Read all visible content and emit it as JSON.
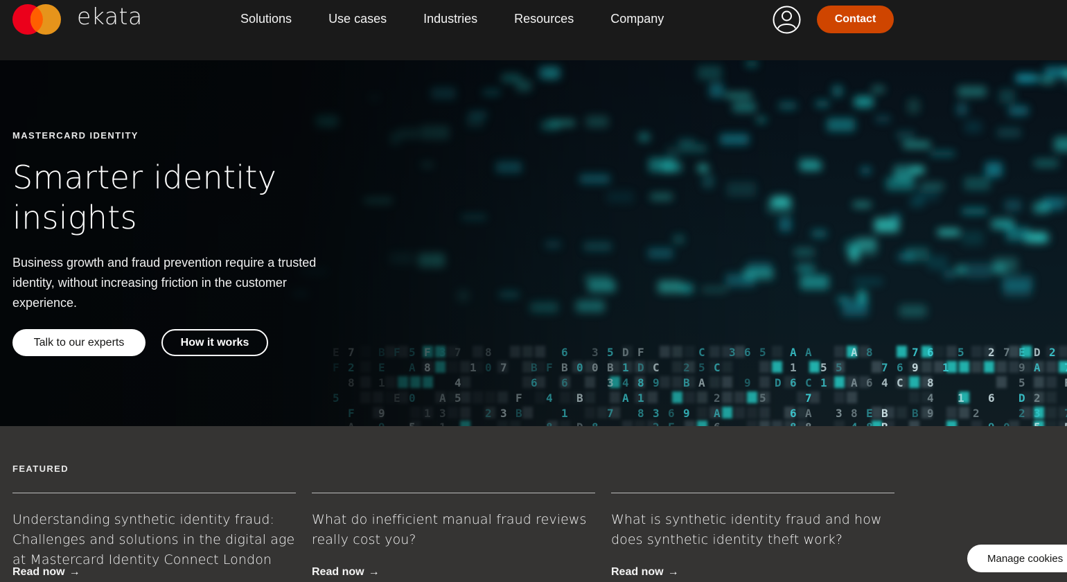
{
  "brand": {
    "wordmark": "ekata",
    "colors": {
      "red": "#eb001b",
      "orange": "#f79e1b",
      "accent": "#cf4500"
    }
  },
  "nav": {
    "items": [
      {
        "label": "Solutions"
      },
      {
        "label": "Use cases"
      },
      {
        "label": "Industries"
      },
      {
        "label": "Resources"
      },
      {
        "label": "Company"
      }
    ],
    "account_icon": "user-circle-icon",
    "contact_label": "Contact"
  },
  "hero": {
    "eyebrow": "MASTERCARD IDENTITY",
    "title": "Smarter identity insights",
    "description": "Business growth and fraud prevention require a trusted identity, without increasing friction in the customer experience.",
    "primary_button": "Talk to our experts",
    "secondary_button": "How it works"
  },
  "featured": {
    "label": "FEATURED",
    "cards": [
      {
        "title": "Understanding synthetic identity fraud: Challenges and solutions in the digital age at Mastercard Identity Connect London",
        "link": "Read now"
      },
      {
        "title": "What do inefficient manual fraud reviews really cost you?",
        "link": "Read now"
      },
      {
        "title": "What is synthetic identity fraud and how does synthetic identity theft work?",
        "link": "Read now"
      }
    ]
  },
  "cookies": {
    "label": "Manage cookies"
  }
}
